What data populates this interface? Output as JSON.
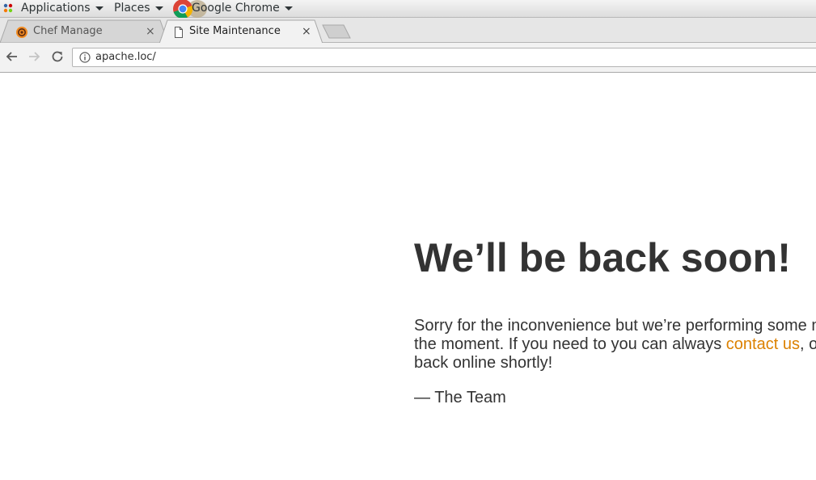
{
  "topbar": {
    "applications_label": "Applications",
    "places_label": "Places",
    "chrome_label": "Google Chrome"
  },
  "tabs": [
    {
      "title": "Chef Manage",
      "close": "×",
      "icon": "chef-favicon",
      "active": false
    },
    {
      "title": "Site Maintenance",
      "close": "×",
      "icon": "page-icon",
      "active": true
    }
  ],
  "toolbar": {
    "url": "apache.loc/"
  },
  "page": {
    "heading": "We’ll be back soon!",
    "text_before_link": "Sorry for the inconvenience but we’re performing some maintenance at the moment. If you need to you can always ",
    "link_text": "contact us",
    "text_after_link": ", otherwise we’ll be back online shortly!",
    "signature": "— The Team"
  },
  "colors": {
    "link": "#dc8100",
    "text": "#333333",
    "panel": "#e6e6e6"
  }
}
